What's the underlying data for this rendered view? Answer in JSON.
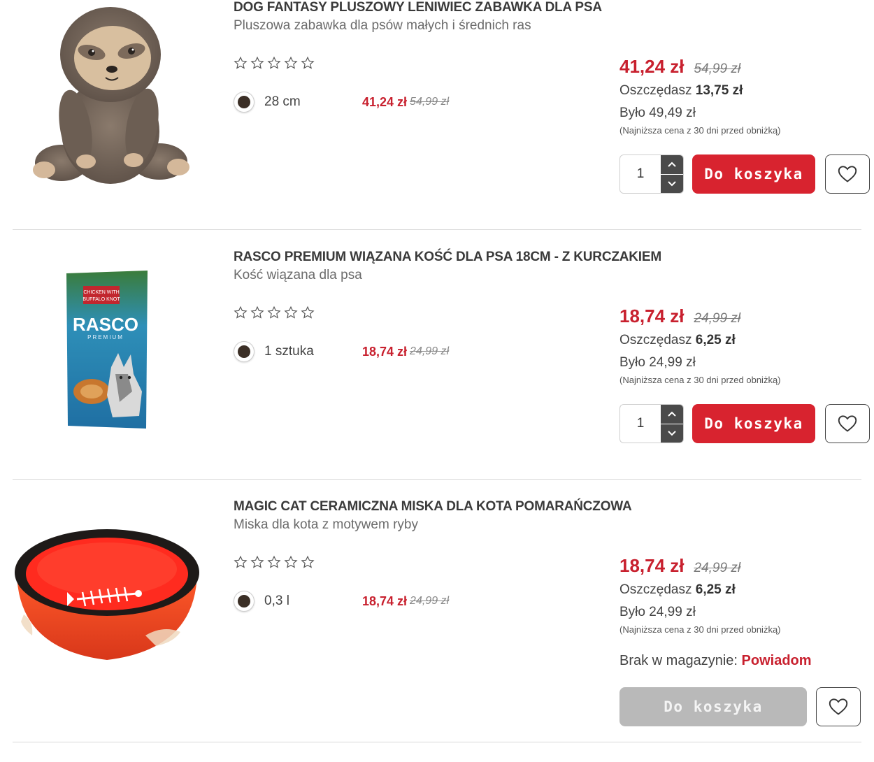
{
  "products": [
    {
      "title": "DOG FANTASY PLUSZOWY LENIWIEC ZABAWKA DLA PSA",
      "subtitle": "Pluszowa zabawka dla psów małych i średnich ras",
      "rating": 0,
      "variant": {
        "label": "28 cm",
        "price": "41,24 zł",
        "old_price": "54,99 zł"
      },
      "price": "41,24 zł",
      "old_price": "54,99 zł",
      "save_label": "Oszczędasz",
      "save_value": "13,75 zł",
      "was": "Było 49,49 zł",
      "note": "(Najniższa cena z 30 dni przed obniżką)",
      "quantity": "1",
      "cart_label": "Do koszyka",
      "in_stock": true
    },
    {
      "title": "RASCO PREMIUM WIĄZANA KOŚĆ DLA PSA 18CM - Z KURCZAKIEM",
      "subtitle": "Kość wiązana dla psa",
      "rating": 0,
      "variant": {
        "label": "1 sztuka",
        "price": "18,74 zł",
        "old_price": "24,99 zł"
      },
      "price": "18,74 zł",
      "old_price": "24,99 zł",
      "save_label": "Oszczędasz",
      "save_value": "6,25 zł",
      "was": "Było 24,99 zł",
      "note": "(Najniższa cena z 30 dni przed obniżką)",
      "quantity": "1",
      "cart_label": "Do koszyka",
      "in_stock": true,
      "package_text": {
        "line1": "CHICKEN WITH",
        "line2": "BUFFALO KNOT",
        "brand": "RASCO",
        "sub": "PREMIUM"
      }
    },
    {
      "title": "MAGIC CAT CERAMICZNA MISKA DLA KOTA POMARAŃCZOWA",
      "subtitle": "Miska dla kota z motywem ryby",
      "rating": 0,
      "variant": {
        "label": "0,3 l",
        "price": "18,74 zł",
        "old_price": "24,99 zł"
      },
      "price": "18,74 zł",
      "old_price": "24,99 zł",
      "save_label": "Oszczędasz",
      "save_value": "6,25 zł",
      "was": "Było 24,99 zł",
      "note": "(Najniższa cena z 30 dni przed obniżką)",
      "stock_label": "Brak w magazynie:",
      "notify_label": "Powiadom",
      "cart_label": "Do koszyka",
      "in_stock": false
    }
  ],
  "colors": {
    "accent": "#d8232f",
    "price": "#c8202e",
    "disabled": "#b9b9b9"
  },
  "icons": {
    "star": "star-outline-icon",
    "heart": "heart-outline-icon",
    "up": "chevron-up-icon",
    "down": "chevron-down-icon"
  }
}
